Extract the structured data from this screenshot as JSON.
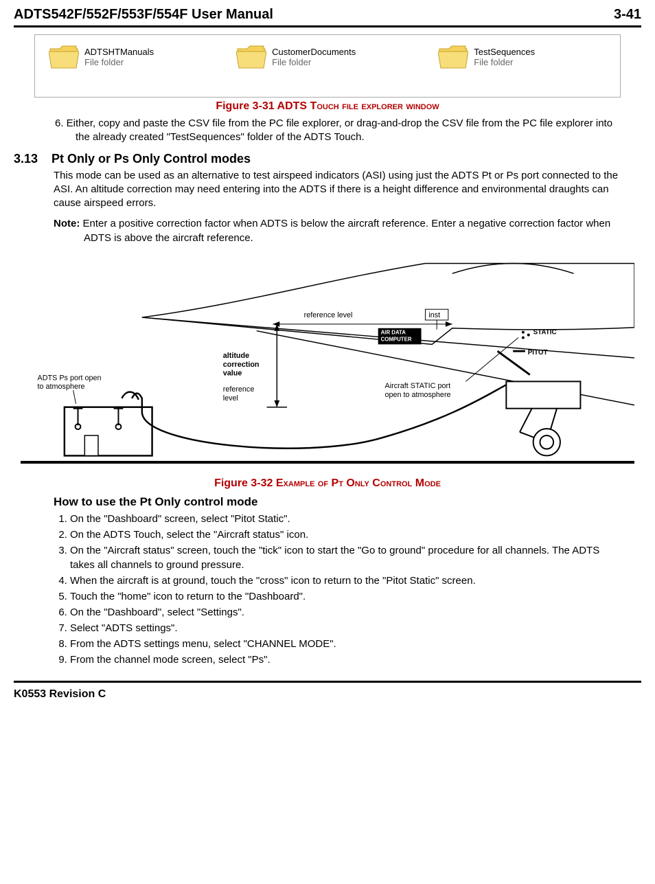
{
  "header": {
    "title": "ADTS542F/552F/553F/554F User Manual",
    "page_number": "3-41"
  },
  "explorer": {
    "folders": [
      {
        "name": "ADTSHTManuals",
        "type": "File folder"
      },
      {
        "name": "CustomerDocuments",
        "type": "File folder"
      },
      {
        "name": "TestSequences",
        "type": "File folder"
      }
    ]
  },
  "fig31_caption_prefix": "Figure 3-31 ADTS T",
  "fig31_caption_suffix": "ouch file explorer window",
  "step6": "6. Either, copy and paste the CSV file from the PC file explorer, or drag-and-drop the CSV file from the PC file explorer into the already created \"TestSequences\" folder of the ADTS Touch.",
  "section": {
    "number": "3.13",
    "title": "Pt Only or Ps Only Control modes"
  },
  "section_para": "This mode can be used as an alternative to test airspeed indicators (ASI) using just the ADTS Pt or Ps port connected to the ASI. An altitude correction may need entering into the ADTS if there is a height difference and environmental draughts can cause airspeed errors.",
  "note_label": "Note:",
  "note_text": " Enter a positive correction factor when ADTS is below the aircraft reference. Enter a negative correction factor when ADTS is above the aircraft reference.",
  "diagram": {
    "ref_level_upper": "reference level",
    "inst_box": "inst",
    "air_data_line1": "AIR DATA",
    "air_data_line2": "COMPUTER",
    "static_label": "STATIC",
    "pitot_label": "PITOT",
    "alt_corr_l1": "altitude",
    "alt_corr_l2": "correction",
    "alt_corr_l3": "value",
    "adts_l1": "ADTS Ps port open",
    "adts_l2": "to atmosphere",
    "ref_level_lower_l1": "reference",
    "ref_level_lower_l2": "level",
    "static_port_l1": "Aircraft STATIC port",
    "static_port_l2": "open to atmosphere"
  },
  "fig32_caption_prefix": "Figure 3-32 E",
  "fig32_caption_mid1": "xample of",
  "fig32_caption_mid2": " P",
  "fig32_caption_mid3": "t",
  "fig32_caption_mid4": " O",
  "fig32_caption_mid5": "nly",
  "fig32_caption_mid6": " C",
  "fig32_caption_mid7": "ontrol",
  "fig32_caption_mid8": " M",
  "fig32_caption_suffix": "ode",
  "subheading": "How to use the Pt Only control mode",
  "steps": [
    "On the \"Dashboard\" screen, select \"Pitot Static\".",
    "On the ADTS Touch, select the \"Aircraft status\" icon.",
    "On the \"Aircraft status\" screen, touch the \"tick\" icon to start the \"Go to ground\" procedure for all channels. The ADTS takes all channels to ground pressure.",
    "When the aircraft is at ground, touch the \"cross\" icon to return to the \"Pitot Static\" screen.",
    "Touch the \"home\" icon to return to the \"Dashboard\".",
    "On the \"Dashboard\", select \"Settings\".",
    "Select \"ADTS settings\".",
    "From the ADTS settings menu, select \"CHANNEL MODE\".",
    "From the channel mode screen, select \"Ps\"."
  ],
  "footer": "K0553 Revision C"
}
